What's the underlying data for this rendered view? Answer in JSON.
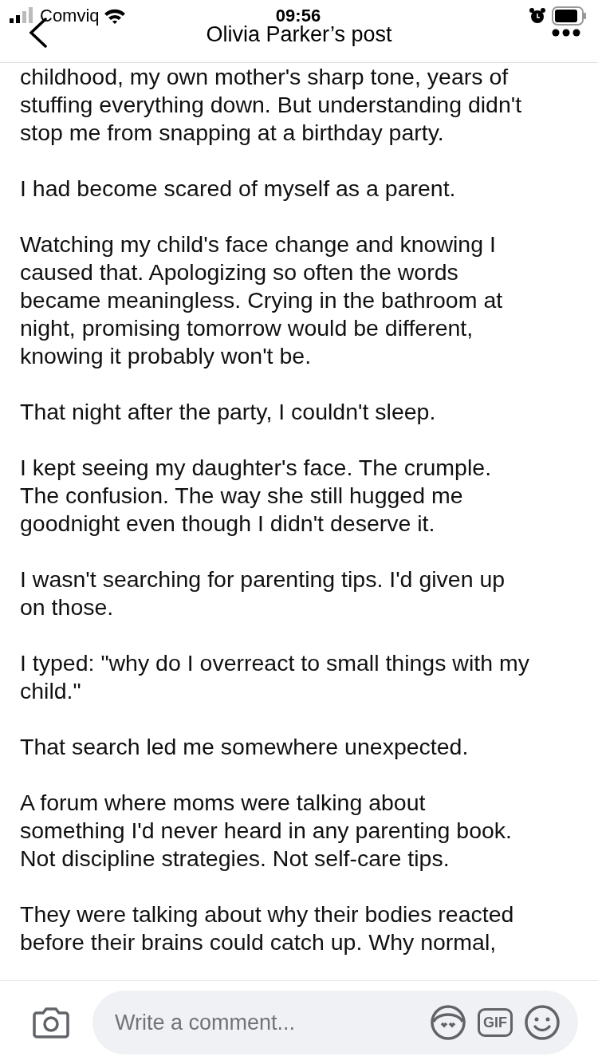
{
  "status_bar": {
    "carrier": "Comviq",
    "time": "09:56"
  },
  "header": {
    "title": "Olivia Parker’s post"
  },
  "post": {
    "paragraphs": [
      {
        "lines": [
          "childhood, my own mother's sharp tone, years of",
          "stuffing everything down. But understanding didn't",
          "stop me from snapping at a birthday party."
        ]
      },
      {
        "lines": [
          "I had become scared of myself as a parent."
        ]
      },
      {
        "lines": [
          "Watching my child's face change and knowing I",
          "caused that. Apologizing so often the words",
          "became meaningless. Crying in the bathroom at",
          "night, promising tomorrow would be different,",
          "knowing it probably won't be."
        ]
      },
      {
        "lines": [
          "That night after the party, I couldn't sleep."
        ]
      },
      {
        "lines": [
          "I kept seeing my daughter's face. The crumple.",
          "The confusion. The way she still hugged me",
          "goodnight even though I didn't deserve it."
        ]
      },
      {
        "lines": [
          "I wasn't searching for parenting tips. I'd given up",
          "on those."
        ]
      },
      {
        "lines": [
          "I typed: \"why do I overreact to small things with my",
          "child.\""
        ]
      },
      {
        "lines": [
          "That search led me somewhere unexpected."
        ]
      },
      {
        "lines": [
          "A forum where moms were talking about",
          "something I'd never heard in any parenting book.",
          "Not discipline strategies. Not self-care tips."
        ]
      },
      {
        "lines": [
          "They were talking about why their bodies reacted",
          "before their brains could catch up. Why normal,"
        ]
      }
    ]
  },
  "comment_bar": {
    "placeholder": "Write a comment...",
    "gif_label": "GIF"
  }
}
